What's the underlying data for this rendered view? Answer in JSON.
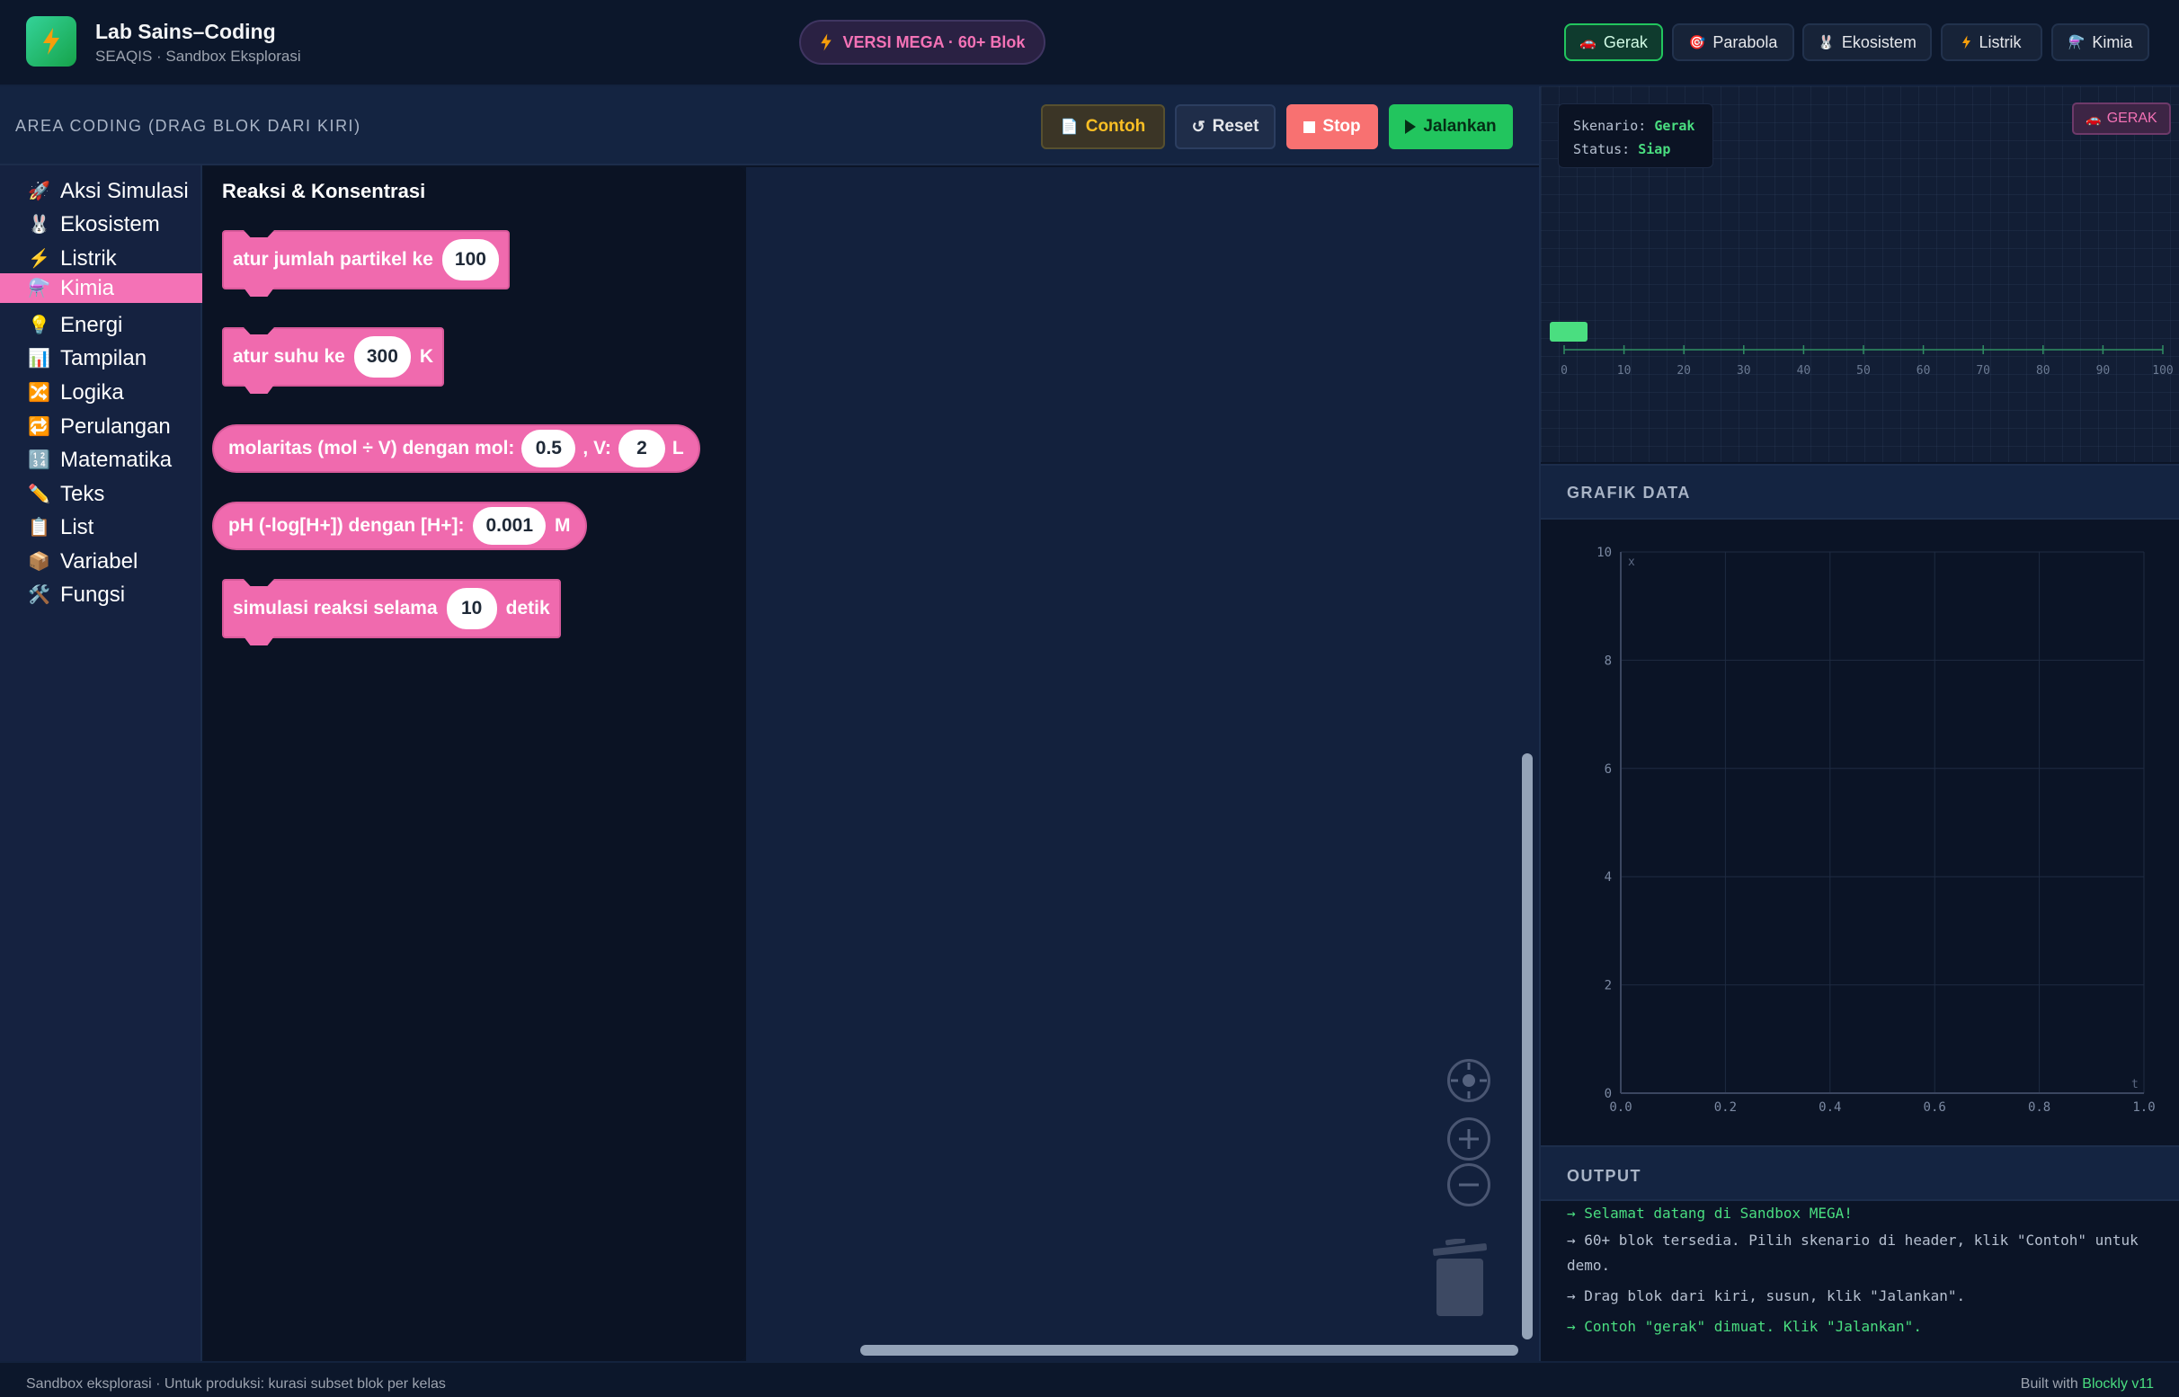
{
  "app": {
    "title": "Lab Sains–Coding",
    "subtitle": "SEAQIS · Sandbox Eksplorasi",
    "version_badge": "VERSI MEGA · 60+ Blok"
  },
  "scenario_tabs": [
    {
      "label": "Gerak",
      "icon": "car-icon",
      "active": true
    },
    {
      "label": "Parabola",
      "icon": "target-icon",
      "active": false
    },
    {
      "label": "Ekosistem",
      "icon": "rabbit-icon",
      "active": false
    },
    {
      "label": "Listrik",
      "icon": "lightning-icon",
      "active": false
    },
    {
      "label": "Kimia",
      "icon": "flask-icon",
      "active": false
    }
  ],
  "coding": {
    "title": "AREA CODING (DRAG BLOK DARI KIRI)",
    "buttons": {
      "contoh": "Contoh",
      "reset": "Reset",
      "stop": "Stop",
      "run": "Jalankan"
    }
  },
  "toolbox": [
    {
      "label": "Aksi Simulasi",
      "icon": "🚀"
    },
    {
      "label": "Ekosistem",
      "icon": "🐰"
    },
    {
      "label": "Listrik",
      "icon": "⚡"
    },
    {
      "label": "Kimia",
      "icon": "⚗️",
      "active": true
    },
    {
      "label": "Energi",
      "icon": "💡"
    },
    {
      "label": "Tampilan",
      "icon": "📊"
    },
    {
      "label": "Logika",
      "icon": "🔀"
    },
    {
      "label": "Perulangan",
      "icon": "🔁"
    },
    {
      "label": "Matematika",
      "icon": "🔢"
    },
    {
      "label": "Teks",
      "icon": "✏️"
    },
    {
      "label": "List",
      "icon": "📋"
    },
    {
      "label": "Variabel",
      "icon": "📦"
    },
    {
      "label": "Fungsi",
      "icon": "🛠️"
    }
  ],
  "flyout": {
    "title": "Reaksi & Konsentrasi",
    "blocks": {
      "particles": {
        "text": "atur jumlah partikel ke",
        "value": "100"
      },
      "temperature": {
        "text": "atur suhu ke",
        "value": "300",
        "unit": "K"
      },
      "molarity": {
        "text": "molaritas (mol ÷ V) dengan mol:",
        "mol": "0.5",
        "sep": ", V:",
        "volume": "2",
        "unit": "L"
      },
      "ph": {
        "text": "pH (-log[H+]) dengan [H+]:",
        "value": "0.001",
        "unit": "M"
      },
      "simulate": {
        "text": "simulasi reaksi selama",
        "value": "10",
        "unit": "detik"
      }
    }
  },
  "simulation": {
    "scenario_label": "Skenario:",
    "scenario_value": "Gerak",
    "status_label": "Status:",
    "status_value": "Siap",
    "badge": "GERAK",
    "track_ticks": [
      "0",
      "10",
      "20",
      "30",
      "40",
      "50",
      "60",
      "70",
      "80",
      "90",
      "100"
    ],
    "object_position": 0,
    "accent": "#4ade80"
  },
  "graph": {
    "title": "GRAFIK DATA"
  },
  "chart_data": {
    "type": "line",
    "title": "",
    "xlabel": "t",
    "ylabel": "x",
    "x_ticks": [
      "0.0",
      "0.2",
      "0.4",
      "0.6",
      "0.8",
      "1.0"
    ],
    "y_ticks": [
      "0",
      "2",
      "4",
      "6",
      "8",
      "10"
    ],
    "xlim": [
      0,
      1
    ],
    "ylim": [
      0,
      10
    ],
    "series": [],
    "grid": true
  },
  "output": {
    "title": "OUTPUT",
    "lines": [
      {
        "text": "→ Selamat datang di Sandbox MEGA!",
        "highlight": true
      },
      {
        "text": "→ 60+ blok tersedia. Pilih skenario di header, klik \"Contoh\" untuk demo.",
        "highlight": false
      },
      {
        "text": "→ Drag blok dari kiri, susun, klik \"Jalankan\".",
        "highlight": false
      },
      {
        "text": "→ Contoh \"gerak\" dimuat. Klik \"Jalankan\".",
        "highlight": true
      }
    ]
  },
  "footer": {
    "left": "Sandbox eksplorasi · Untuk produksi: kurasi subset blok per kelas",
    "right_prefix": "Built with",
    "right_link": "Blockly v11"
  },
  "colors": {
    "accent_green": "#22c55e",
    "accent_pink": "#f472b6",
    "stop_red": "#f87171",
    "contoh_amber": "#fbbf24"
  }
}
